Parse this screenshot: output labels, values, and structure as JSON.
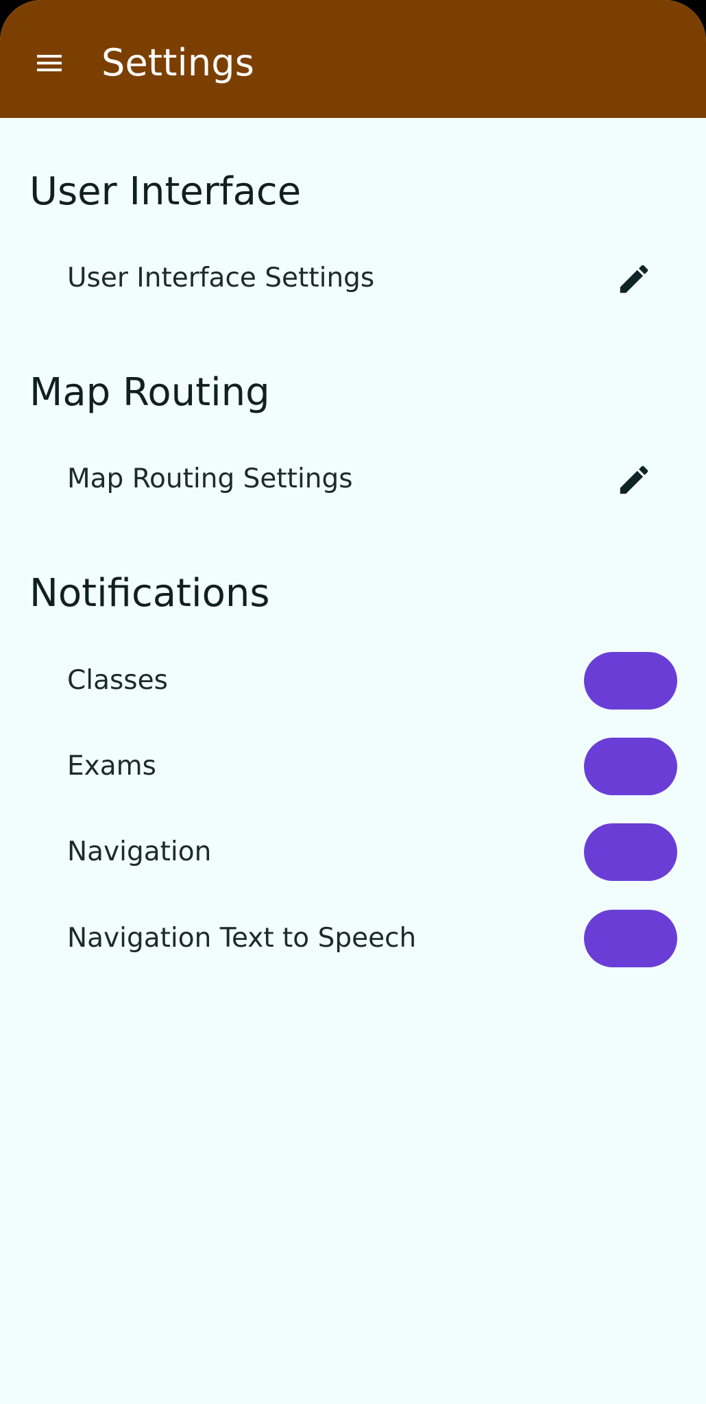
{
  "app_bar": {
    "title": "Settings",
    "menu_icon": "menu-icon",
    "background_color": "#7c3f02"
  },
  "sections": {
    "user_interface": {
      "header": "User Interface",
      "item_label": "User Interface Settings",
      "action_icon": "edit-icon"
    },
    "map_routing": {
      "header": "Map Routing",
      "item_label": "Map Routing Settings",
      "action_icon": "edit-icon"
    },
    "notifications": {
      "header": "Notifications",
      "toggle_color": "#6a3ed6",
      "items": [
        {
          "label": "Classes",
          "enabled": true
        },
        {
          "label": "Exams",
          "enabled": true
        },
        {
          "label": "Navigation",
          "enabled": true
        },
        {
          "label": "Navigation Text to Speech",
          "enabled": true
        }
      ]
    }
  },
  "colors": {
    "background": "#f2fdfe",
    "text": "#121f1f",
    "icon": "#0f2424"
  }
}
